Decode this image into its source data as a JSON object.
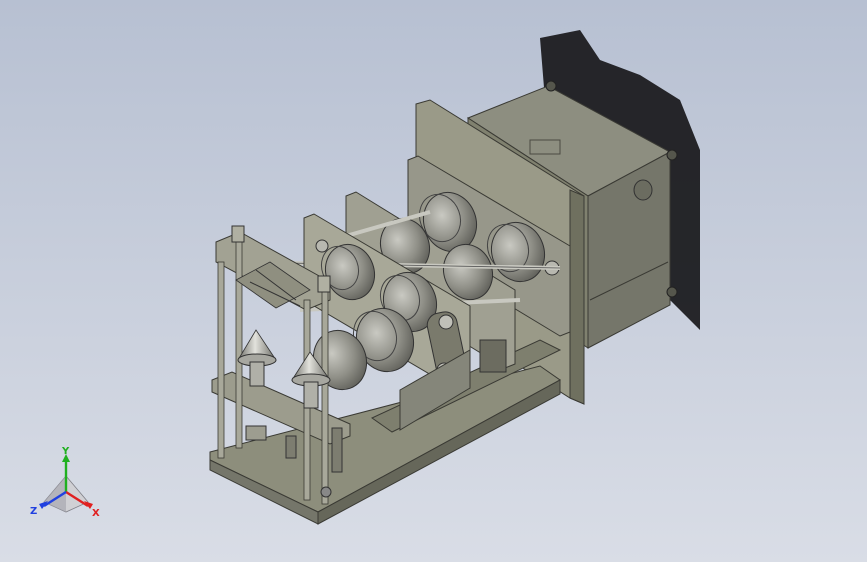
{
  "view": {
    "background_top": "#b7c0d2",
    "background_bottom": "#d9dde6",
    "model_color": "#8a8a78",
    "model_shadow_color": "#1c1c20"
  },
  "triad": {
    "x_label": "X",
    "y_label": "Y",
    "z_label": "Z",
    "x_color": "#e02020",
    "y_color": "#20b020",
    "z_color": "#2040e0"
  }
}
